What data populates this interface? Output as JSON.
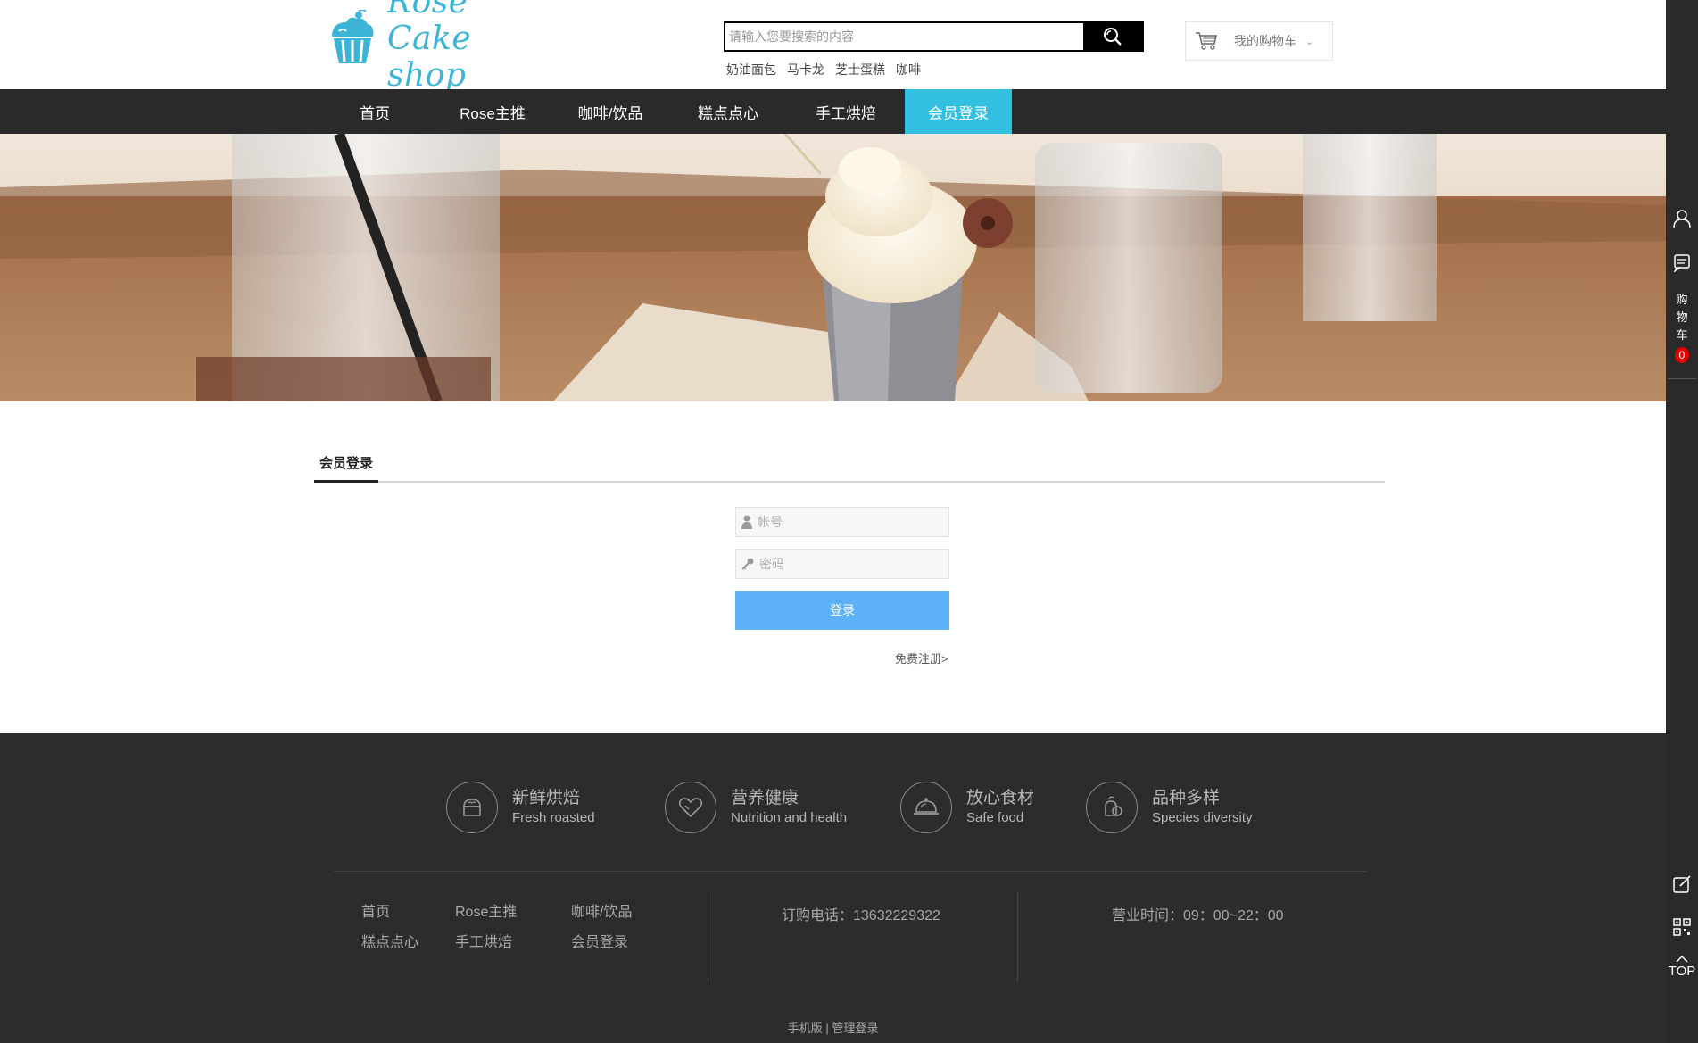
{
  "header": {
    "logo_text": "Rose Cake shop",
    "search_placeholder": "请输入您要搜索的内容",
    "hot_words": [
      "奶油面包",
      "马卡龙",
      "芝士蛋糕",
      "咖啡"
    ],
    "cart_label": "我的购物车"
  },
  "nav": {
    "items": [
      "首页",
      "Rose主推",
      "咖啡/饮品",
      "糕点点心",
      "手工烘焙",
      "会员登录"
    ],
    "active_index": 5
  },
  "login": {
    "section_title": "会员登录",
    "account_placeholder": "帐号",
    "password_placeholder": "密码",
    "login_button": "登录",
    "register_link": "免费注册>"
  },
  "footer": {
    "features": [
      {
        "title": "新鲜烘焙",
        "subtitle": "Fresh roasted",
        "icon": "cake-icon"
      },
      {
        "title": "营养健康",
        "subtitle": "Nutrition and health",
        "icon": "heart-icon"
      },
      {
        "title": "放心食材",
        "subtitle": "Safe food",
        "icon": "dish-icon"
      },
      {
        "title": "品种多样",
        "subtitle": "Species diversity",
        "icon": "variety-icon"
      }
    ],
    "links_row1": [
      "首页",
      "Rose主推",
      "咖啡/饮品"
    ],
    "links_row2": [
      "糕点点心",
      "手工烘焙",
      "会员登录"
    ],
    "phone": "订购电话：13632229322",
    "hours": "营业时间：09：00~22：00",
    "bottom_mobile": "手机版",
    "bottom_admin": "管理登录"
  },
  "sidebar": {
    "cart_text": "购物车",
    "cart_count": "0",
    "top_label": "TOP"
  },
  "colors": {
    "accent": "#33c0e0",
    "nav_bg": "#2a2a2a",
    "footer_bg": "#2c2c2c",
    "login_button": "#5cb1f7",
    "cart_badge": "#e00000"
  }
}
